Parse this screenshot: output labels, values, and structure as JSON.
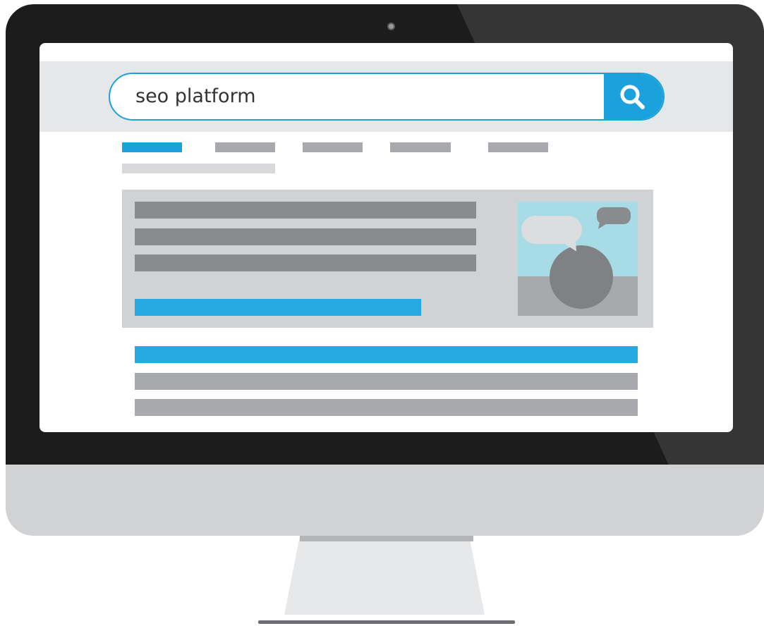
{
  "search": {
    "query": "seo platform"
  },
  "icons": {
    "search_button": "search-icon",
    "camera": "camera-dot",
    "thumbnail": "chat-bubbles-user-image"
  },
  "colors": {
    "accent": "#1ba1db",
    "link": "#27aae1",
    "bezel": "#1c1c1c",
    "placeholder_dark": "#8a8b8d",
    "placeholder_light": "#a7a9ac"
  },
  "tabs": {
    "count": 5,
    "active_index": 0
  }
}
